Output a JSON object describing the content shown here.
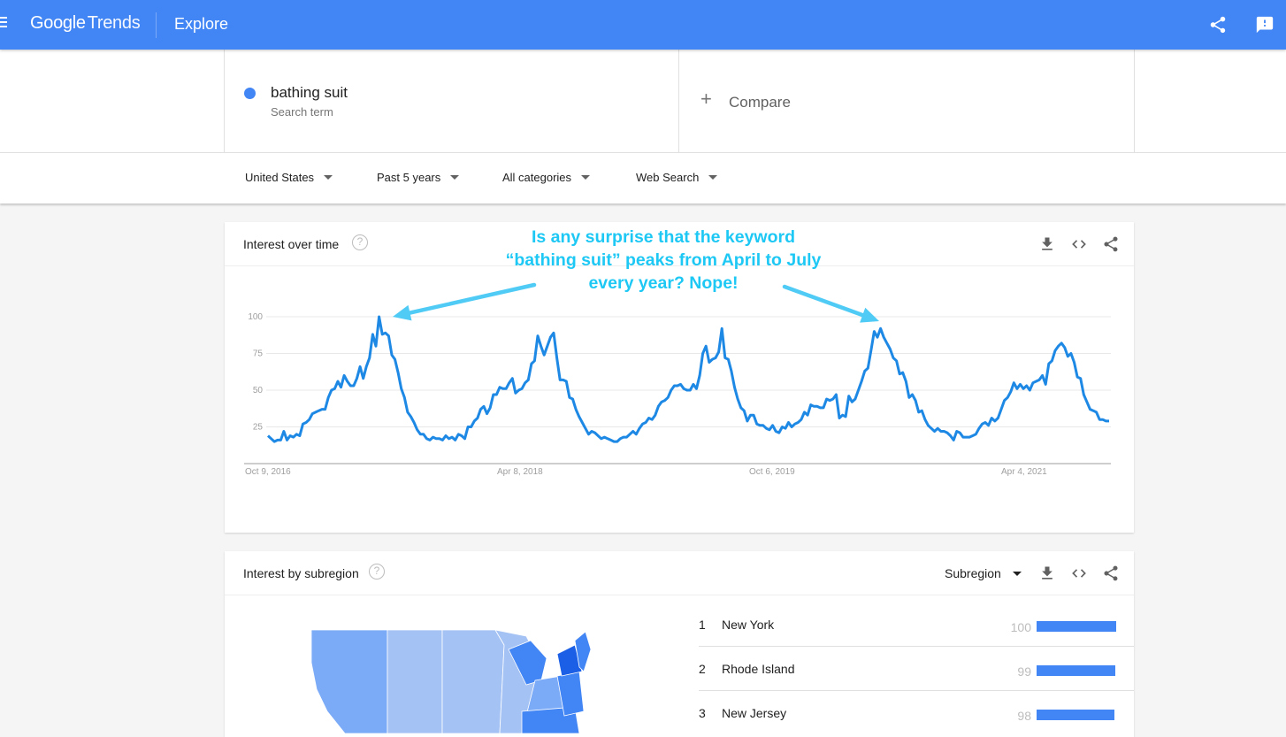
{
  "topbar": {
    "logo_google": "Google",
    "logo_trends": "Trends",
    "section": "Explore",
    "icons": [
      "menu-icon",
      "share-icon",
      "feedback-icon"
    ]
  },
  "search": {
    "term": "bathing suit",
    "term_type": "Search term",
    "term_color": "#4285f4",
    "compare_label": "Compare"
  },
  "filters": {
    "region": "United States",
    "time": "Past 5 years",
    "category": "All categories",
    "property": "Web Search"
  },
  "interest_over_time": {
    "title": "Interest over time",
    "help": "?",
    "annotation": "Is any surprise that the keyword “bathing suit” peaks from April to July every year? Nope!",
    "annotation_color": "#1ec8f4",
    "icons": [
      "download-icon",
      "embed-icon",
      "share-icon"
    ]
  },
  "chart_data": {
    "type": "line",
    "title": "Interest over time",
    "series": [
      {
        "name": "bathing suit",
        "color": "#1e88e5",
        "values": [
          19,
          17,
          15,
          16,
          16,
          22,
          16,
          19,
          18,
          20,
          19,
          27,
          28,
          30,
          34,
          35,
          36,
          37,
          37,
          45,
          50,
          51,
          56,
          52,
          60,
          56,
          53,
          53,
          58,
          66,
          58,
          66,
          72,
          88,
          80,
          100,
          88,
          89,
          87,
          74,
          71,
          62,
          51,
          45,
          35,
          32,
          28,
          23,
          20,
          20,
          17,
          16,
          18,
          17,
          17,
          16,
          19,
          17,
          18,
          16,
          20,
          19,
          17,
          25,
          25,
          29,
          31,
          37,
          39,
          34,
          38,
          47,
          47,
          52,
          51,
          51,
          55,
          58,
          48,
          50,
          51,
          55,
          57,
          68,
          70,
          87,
          80,
          74,
          80,
          86,
          89,
          72,
          57,
          57,
          56,
          45,
          44,
          37,
          32,
          28,
          24,
          20,
          22,
          21,
          19,
          17,
          18,
          17,
          16,
          15,
          15,
          17,
          18,
          18,
          20,
          22,
          20,
          24,
          27,
          28,
          31,
          30,
          33,
          39,
          42,
          43,
          45,
          50,
          53,
          53,
          54,
          51,
          50,
          50,
          54,
          51,
          60,
          75,
          80,
          69,
          71,
          72,
          76,
          92,
          72,
          71,
          63,
          52,
          44,
          38,
          36,
          29,
          33,
          33,
          27,
          26,
          26,
          24,
          23,
          26,
          22,
          21,
          25,
          24,
          28,
          25,
          27,
          28,
          30,
          35,
          33,
          40,
          39,
          39,
          38,
          38,
          44,
          43,
          44,
          47,
          31,
          33,
          32,
          46,
          42,
          44,
          50,
          56,
          63,
          65,
          77,
          90,
          86,
          92,
          86,
          82,
          78,
          72,
          70,
          61,
          62,
          56,
          45,
          47,
          43,
          35,
          36,
          30,
          26,
          24,
          22,
          24,
          22,
          22,
          21,
          19,
          16,
          22,
          21,
          18,
          18,
          18,
          19,
          20,
          24,
          27,
          28,
          26,
          31,
          29,
          31,
          37,
          43,
          45,
          49,
          55,
          51,
          54,
          51,
          53,
          50,
          55,
          56,
          57,
          60,
          54,
          68,
          70,
          77,
          80,
          82,
          79,
          73,
          75,
          69,
          59,
          58,
          47,
          42,
          37,
          36,
          35,
          30,
          30,
          29,
          29
        ],
        "x_start": "Oct 9, 2016",
        "frequency": "weekly"
      }
    ],
    "x_tick_labels": [
      "Oct 9, 2016",
      "Apr 8, 2018",
      "Oct 6, 2019",
      "Apr 4, 2021"
    ],
    "y_ticks": [
      25,
      50,
      75,
      100
    ],
    "ylim": [
      0,
      100
    ],
    "grid": true,
    "xlabel": "",
    "ylabel": "",
    "annotations": [
      {
        "text": "arrow to peak",
        "points_to_index": 35
      },
      {
        "text": "arrow to peak",
        "points_to_index": 193
      }
    ]
  },
  "interest_by_subregion": {
    "title": "Interest by subregion",
    "help": "?",
    "selector": "Subregion",
    "icons": [
      "download-icon",
      "embed-icon",
      "share-icon"
    ],
    "rows": [
      {
        "rank": "1",
        "name": "New York",
        "value": "100",
        "fraction": 1.0
      },
      {
        "rank": "2",
        "name": "Rhode Island",
        "value": "99",
        "fraction": 0.99
      },
      {
        "rank": "3",
        "name": "New Jersey",
        "value": "98",
        "fraction": 0.98
      }
    ],
    "map_colors": {
      "light": "#a4c2f4",
      "mid": "#7baaf7",
      "strong": "#4285f4",
      "max": "#1a5fe6"
    }
  }
}
